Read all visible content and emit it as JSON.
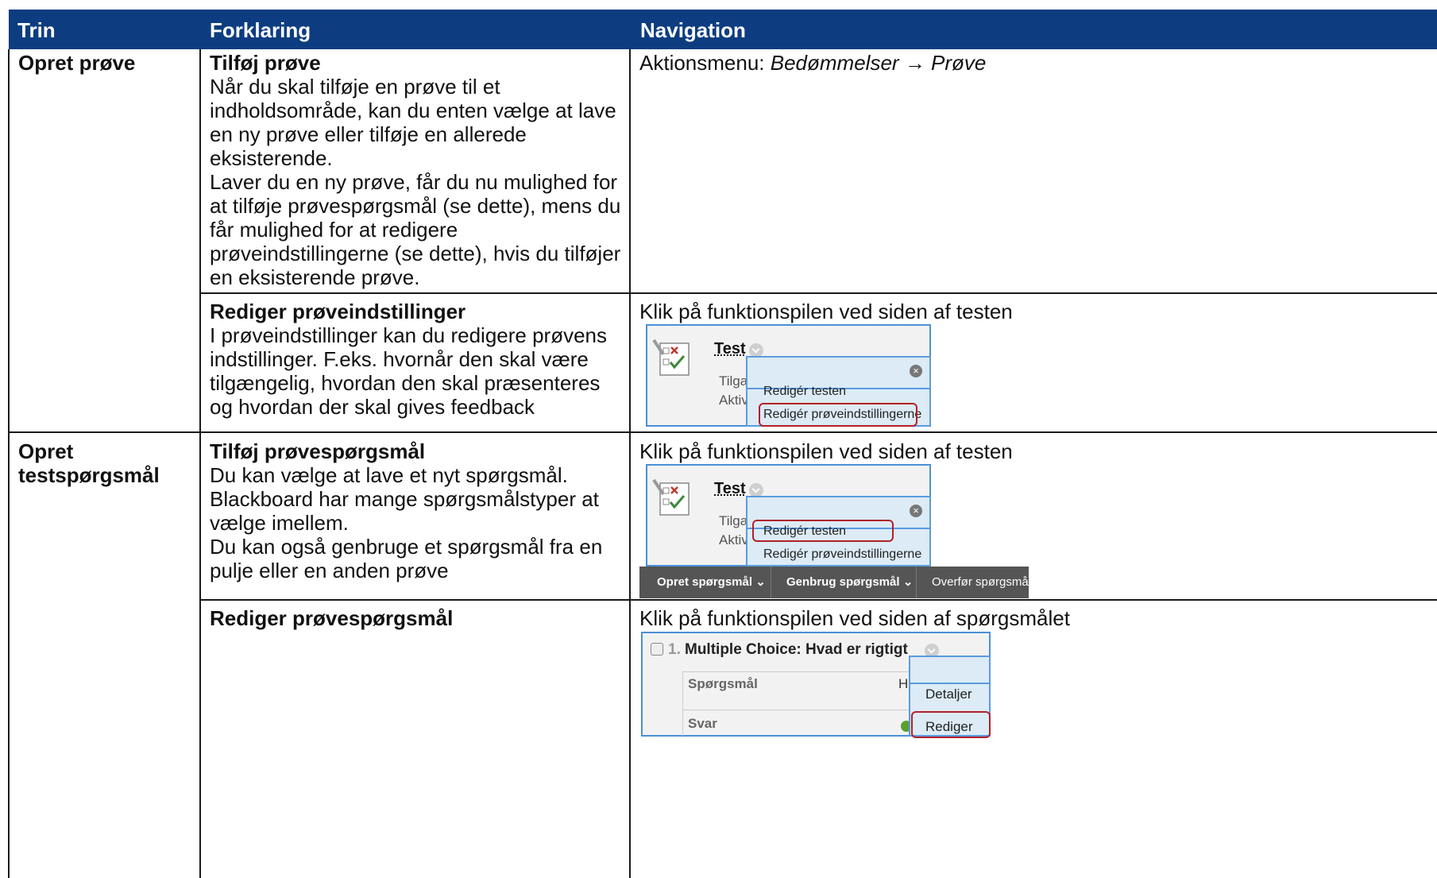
{
  "columns": {
    "trin": "Trin",
    "forklaring": "Forklaring",
    "navigation": "Navigation"
  },
  "rows": {
    "r1": {
      "trin": "Opret prøve",
      "title": "Tilføj prøve",
      "lines": [
        "Når du skal tilføje en prøve til et",
        "indholdsområde, kan du enten vælge at lave",
        "en ny prøve eller tilføje en allerede",
        "eksisterende.",
        "Laver du en ny prøve, får du nu mulighed for",
        "at tilføje prøvespørgsmål (se dette), mens du",
        "får mulighed for at redigere",
        "prøveindstillingerne (se dette), hvis du tilføjer",
        "en eksisterende prøve."
      ],
      "nav_prefix": "Aktionsmenu: ",
      "nav_item1": "Bedømmelser",
      "nav_arrow": "→",
      "nav_item2": "Prøve"
    },
    "r2": {
      "title": "Rediger prøveindstillinger",
      "lines": [
        "I prøveindstillinger kan du redigere prøvens",
        "indstillinger. F.eks. hvornår den skal være",
        "tilgængelig, hvordan den skal præsenteres",
        "og hvordan der skal gives feedback"
      ],
      "nav": "Klik på funktionspilen ved siden af testen"
    },
    "r3": {
      "trin1": "Opret",
      "trin2": "testspørgsmål",
      "title": "Tilføj prøvespørgsmål",
      "lines": [
        "Du kan vælge at lave et nyt spørgsmål.",
        "Blackboard har mange spørgsmålstyper at",
        "vælge imellem.",
        "Du kan også genbruge et spørgsmål fra en",
        "pulje eller en anden prøve"
      ],
      "nav": "Klik på funktionspilen ved siden af testen"
    },
    "r4": {
      "title": "Rediger prøvespørgsmål",
      "nav": "Klik på funktionspilen ved siden af spørgsmålet"
    }
  },
  "shot1": {
    "title": "Test",
    "left1": "Tilga",
    "left2": "Aktiv",
    "menu1": "Redigér testen",
    "menu2": "Redigér prøveindstillingerne"
  },
  "shot2": {
    "title": "Test",
    "left1": "Tilga",
    "left2": "Aktiv",
    "menu1": "Redigér testen",
    "menu2": "Redigér prøveindstillingerne",
    "toolbar": {
      "create": "Opret spørgsmål",
      "reuse": "Genbrug spørgsmål",
      "transfer": "Overfør spørgsmål"
    }
  },
  "shot3": {
    "number": "1.",
    "title": "Multiple Choice: Hvad er rigtigt",
    "label1": "Spørgsmål",
    "partial": "H",
    "label2": "Svar",
    "menu1": "Detaljer",
    "menu2": "Rediger"
  },
  "colors": {
    "header": "#0d3d80",
    "highlight": "#b3202a",
    "menu": "#dcebf5"
  }
}
